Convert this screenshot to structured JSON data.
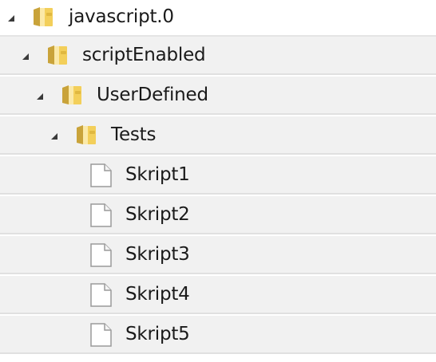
{
  "tree": {
    "root": {
      "label": "javascript.0",
      "icon": "folder-icon",
      "expanded": true
    },
    "scriptEnabled": {
      "label": "scriptEnabled",
      "icon": "folder-icon",
      "expanded": true
    },
    "userDefined": {
      "label": "UserDefined",
      "icon": "folder-icon",
      "expanded": true
    },
    "tests": {
      "label": "Tests",
      "icon": "folder-icon",
      "expanded": true
    },
    "scripts": [
      {
        "label": "Skript1",
        "icon": "file-icon"
      },
      {
        "label": "Skript2",
        "icon": "file-icon"
      },
      {
        "label": "Skript3",
        "icon": "file-icon"
      },
      {
        "label": "Skript4",
        "icon": "file-icon"
      },
      {
        "label": "Skript5",
        "icon": "file-icon"
      }
    ]
  },
  "colors": {
    "folder_main": "#f3cf5a",
    "folder_light": "#fbe9a8",
    "folder_dark": "#c9a33a",
    "file_border": "#9a9a9a",
    "row_bg": "#f1f1f1",
    "text": "#1a1a1a"
  }
}
